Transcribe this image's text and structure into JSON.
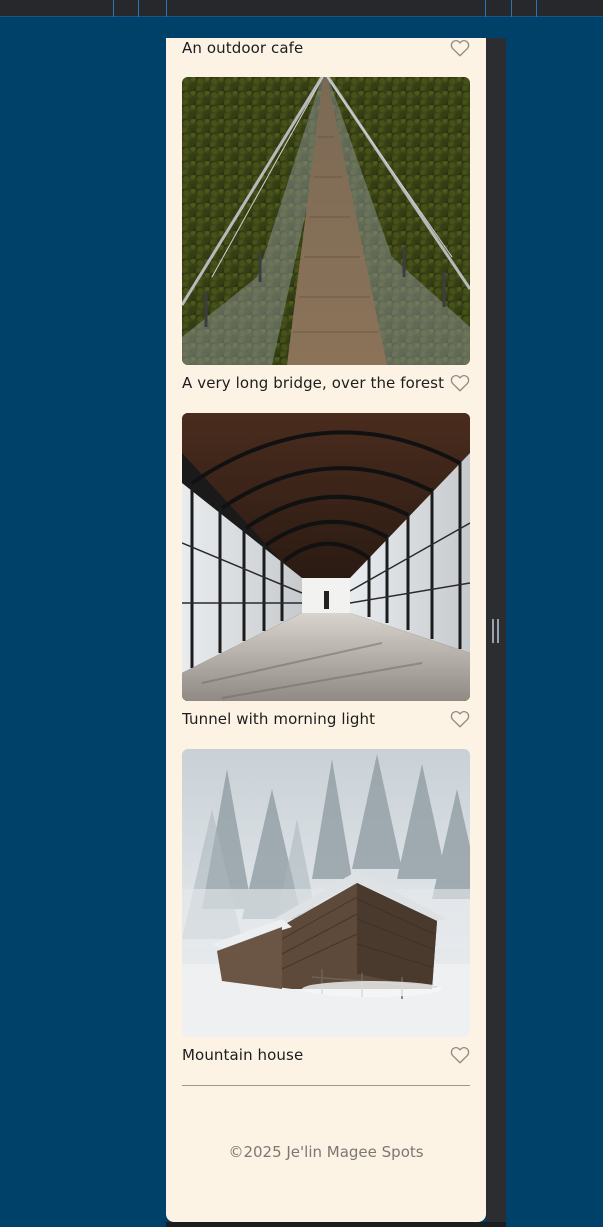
{
  "cards": [
    {
      "title": "An outdoor cafe",
      "image_alt": "",
      "favorited": false
    },
    {
      "title": "A very long bridge, over the forest",
      "image_alt": "Suspension bridge over a forest",
      "favorited": false
    },
    {
      "title": "Tunnel with morning light",
      "image_alt": "Glass-walled covered walkway tunnel",
      "favorited": false
    },
    {
      "title": "Mountain house",
      "image_alt": "Wooden cabin in snowy foggy forest",
      "favorited": false
    }
  ],
  "icons": {
    "like": "heart-outline-icon"
  },
  "footer": {
    "text": "©2025 Je'lin Magee Spots"
  },
  "colors": {
    "page_background": "#00416a",
    "card_background": "#fdf3e4",
    "title_text": "#1d1d1f",
    "footer_text": "#7b7772",
    "heart_stroke": "#8e8a85"
  }
}
